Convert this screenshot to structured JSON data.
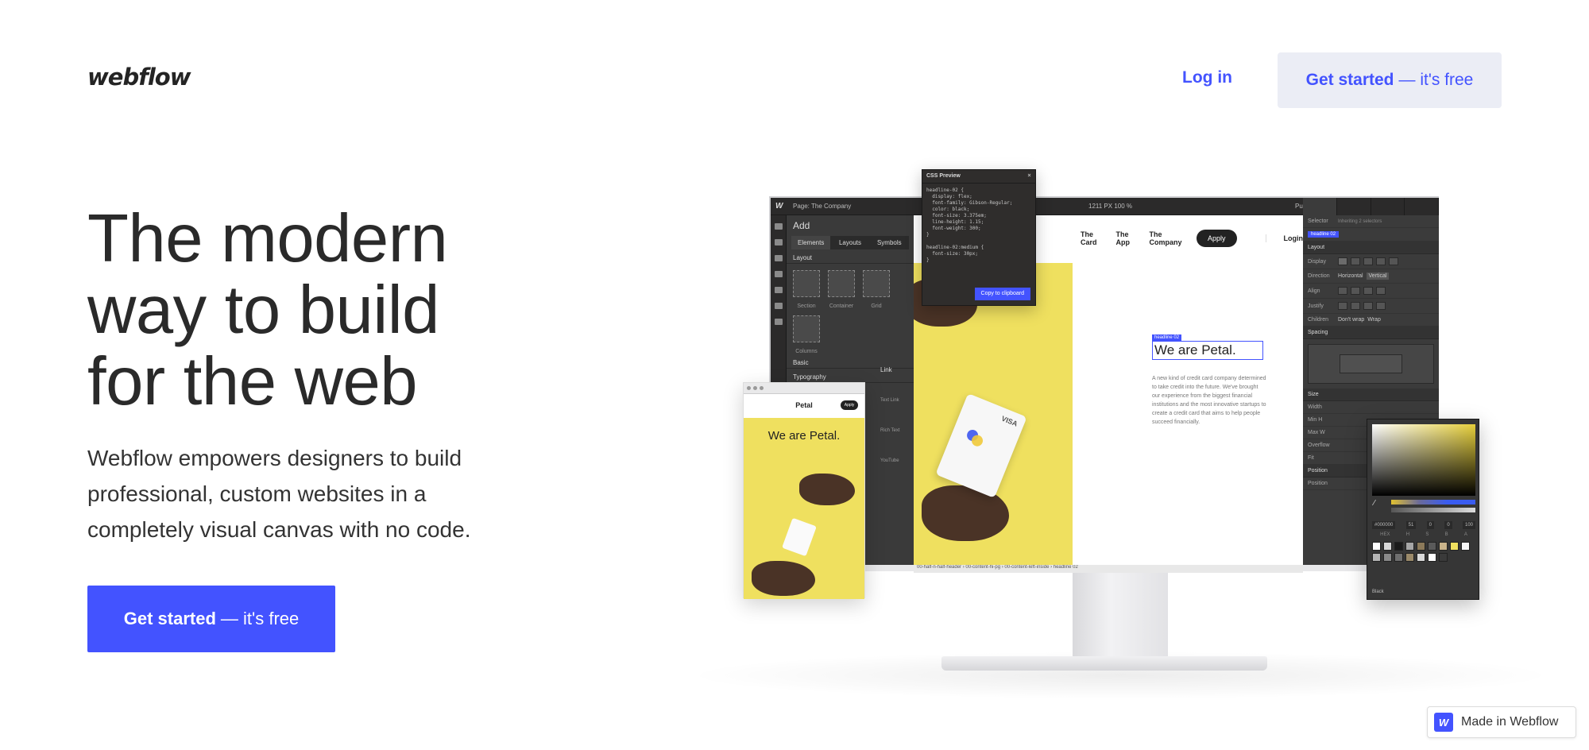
{
  "brand": {
    "logo_text": "webflow",
    "accent_color": "#4353ff"
  },
  "nav": {
    "login_label": "Log in",
    "cta_strong": "Get started",
    "cta_light": "— it's free"
  },
  "hero": {
    "title_lines": [
      "The modern",
      "way to build",
      "for the web"
    ],
    "subtitle": "Webflow empowers designers to build professional, custom websites in a completely visual canvas with no code.",
    "cta_strong": "Get started",
    "cta_light": "— it's free"
  },
  "designer": {
    "page_label": "Page: The Company",
    "zoom_readout": "1211 PX 100 %",
    "publish_label": "Publish",
    "add_panel": {
      "title": "Add",
      "tabs": [
        "Elements",
        "Layouts",
        "Symbols"
      ],
      "section_layout": "Layout",
      "tiles": [
        "Section",
        "Container",
        "Grid"
      ],
      "tile_columns": "Columns",
      "section_basic": "Basic",
      "section_typography": "Typography"
    },
    "site": {
      "nav": [
        "The Card",
        "The App",
        "The Company"
      ],
      "apply_button": "Apply",
      "login": "Login",
      "selected_tag": "headline 02",
      "headline": "We are Petal.",
      "paragraph": "A new kind of credit card company determined to take credit into the future. We've brought our experience from the biggest financial institutions and the most innovative startups to create a credit card that aims to help people succeed financially.",
      "card_brand": "VISA"
    },
    "breadcrumb": "00-half-n-half-header  ›  00-content-hi-pg  ›  00-content-left-inside  ›  headline 02",
    "style_panel": {
      "selector_label": "Selector",
      "selector_value": "headline 02",
      "inheriting": "Inheriting 2 selectors",
      "section_layout": "Layout",
      "display": "Display",
      "direction": "Direction",
      "dir_horizontal": "Horizontal",
      "dir_vertical": "Vertical",
      "align": "Align",
      "justify": "Justify",
      "children": "Children",
      "dont_wrap": "Don't wrap",
      "wrap": "Wrap",
      "section_spacing": "Spacing",
      "section_size": "Size",
      "width": "Width",
      "min_h": "Min H",
      "max_w": "Max W",
      "overflow": "Overflow",
      "fit": "Fit",
      "section_position": "Position",
      "position": "Position"
    },
    "css_preview": {
      "title": "CSS Preview",
      "code": "headline-02 {\n  display: flex;\n  font-family: Gibson-Regular;\n  color: black;\n  font-size: 3.375em;\n  line-height: 1.15;\n  font-weight: 300;\n}\n\nheadline-02:medium {\n  font-size: 30px;\n}",
      "copy_button": "Copy to clipboard"
    },
    "phone": {
      "brand": "Petal",
      "apply": "Apply",
      "headline": "We are Petal."
    },
    "mini_panel": {
      "link": "Link",
      "text_link": "Text Link",
      "rich_text": "Rich Text",
      "youtube": "YouTube"
    },
    "color_picker": {
      "hex": "#000000",
      "values": [
        "51",
        "0",
        "0",
        "100"
      ],
      "labels": [
        "HEX",
        "H",
        "S",
        "B",
        "A"
      ],
      "swatch_colors": [
        "#ffffff",
        "#d8d8d8",
        "#1a1a1a",
        "#a6a6a6",
        "#8c7a5a",
        "#5a5a5a",
        "#c9b38a",
        "#f0e05f",
        "#f7f7f7",
        "#b5b5b5",
        "#8a8a8a",
        "#6f6f6f",
        "#9b8a6a",
        "#dadada",
        "#ffffff",
        "#3a3a3a"
      ],
      "footer_label": "Black"
    }
  },
  "badge": {
    "label": "Made in Webflow",
    "icon": "W"
  }
}
